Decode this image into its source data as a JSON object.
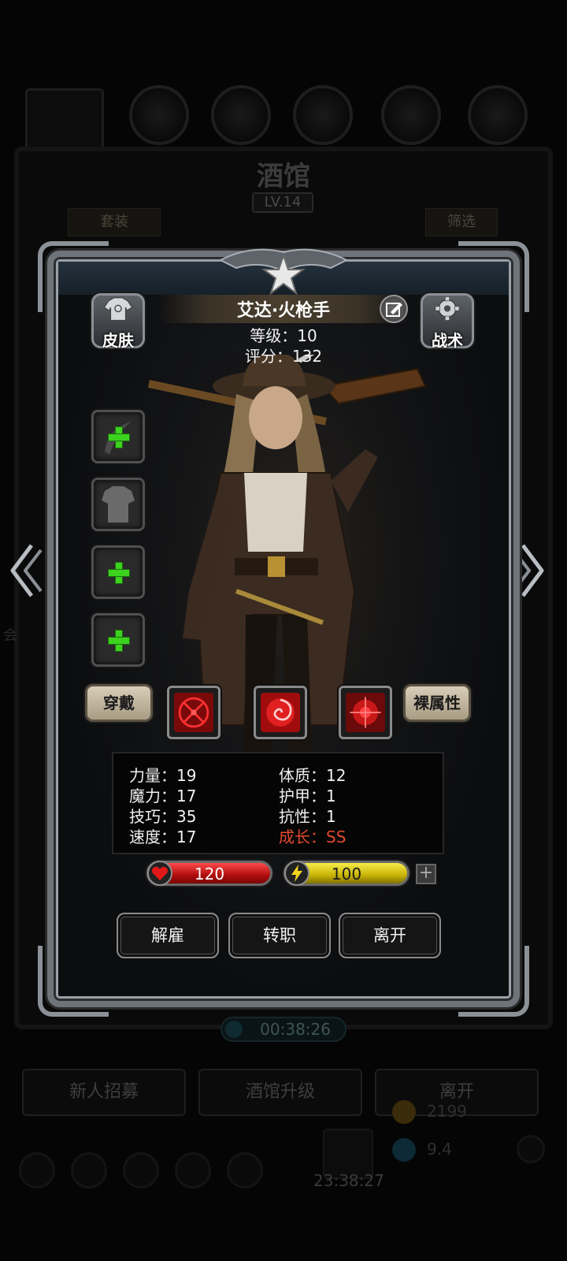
{
  "background": {
    "title": "酒馆",
    "level": "LV.14",
    "tab_left": "套装",
    "tab_right": "筛选",
    "timer": "00:38:26",
    "buttons": [
      "新人招募",
      "酒馆升级",
      "离开"
    ],
    "clock": "23:38:27",
    "resource_1": "2199",
    "resource_2": "9.4"
  },
  "hero": {
    "name": "艾达·火枪手",
    "level_text": "等级：10",
    "score_text": "评分：132"
  },
  "side_buttons": {
    "skin_label": "皮肤",
    "tactic_label": "战术"
  },
  "equip": {
    "wear_label": "穿戴",
    "bare_label": "裸属性"
  },
  "stats": {
    "left": [
      "力量：19",
      "魔力：17",
      "技巧：35",
      "速度：17"
    ],
    "right": [
      "体质：12",
      "护甲：1",
      "抗性：1"
    ],
    "growth": "成长：SS"
  },
  "bars": {
    "hp": "120",
    "energy": "100"
  },
  "actions": {
    "dismiss": "解雇",
    "transfer": "转职",
    "leave": "离开"
  },
  "colors": {
    "growth": "#e14a2e",
    "hp": "#c81010",
    "energy": "#d8c410",
    "slot_plus": "#3cd21e"
  }
}
